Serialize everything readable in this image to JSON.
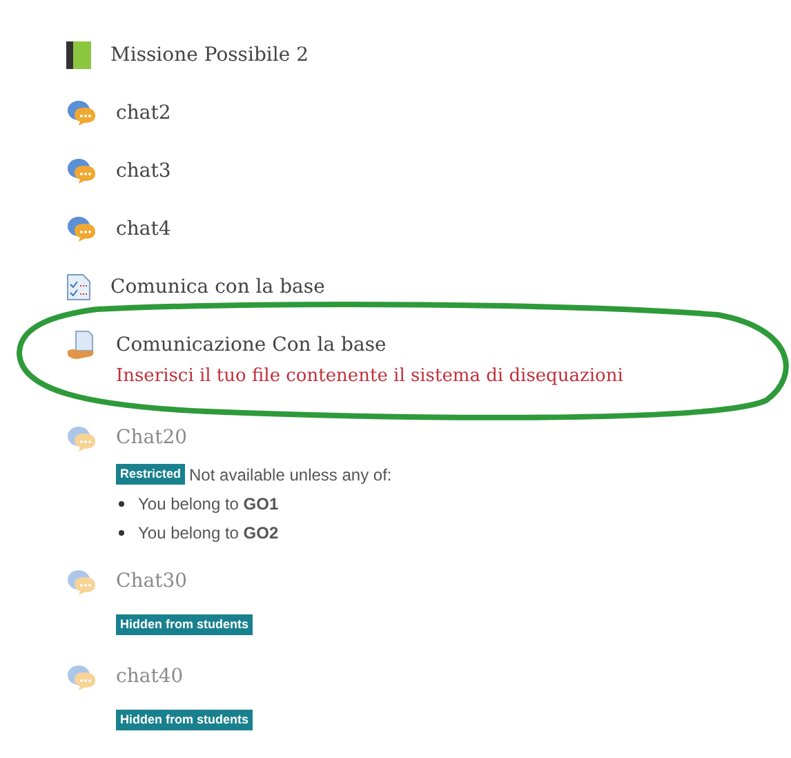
{
  "items": [
    {
      "kind": "book",
      "title": "Missione Possibile 2",
      "dimmed": false
    },
    {
      "kind": "chat",
      "title": "chat2",
      "dimmed": false
    },
    {
      "kind": "chat",
      "title": "chat3",
      "dimmed": false
    },
    {
      "kind": "chat",
      "title": "chat4",
      "dimmed": false
    },
    {
      "kind": "feedback",
      "title": "Comunica con la base",
      "dimmed": false
    },
    {
      "kind": "assignment",
      "title": "Comunicazione Con la base",
      "dimmed": false,
      "circled": true,
      "description": "Inserisci il tuo file contenente il sistema di disequazioni"
    },
    {
      "kind": "chat",
      "title": "Chat20",
      "dimmed": true,
      "restriction": {
        "badge": "Restricted",
        "text": "Not available unless any of:",
        "conditions": [
          "You belong to **GO1**",
          "You belong to **GO2**"
        ]
      }
    },
    {
      "kind": "chat",
      "title": "Chat30",
      "dimmed": true,
      "badge": "Hidden from students"
    },
    {
      "kind": "chat",
      "title": "chat40",
      "dimmed": true,
      "badge": "Hidden from students"
    }
  ]
}
